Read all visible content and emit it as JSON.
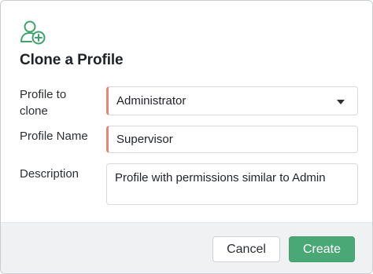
{
  "dialog": {
    "icon": "add-user-icon",
    "title": "Clone a Profile"
  },
  "form": {
    "profile_to_clone": {
      "label": "Profile to clone",
      "value": "Administrator",
      "required": true
    },
    "profile_name": {
      "label": "Profile Name",
      "value": "Supervisor",
      "required": true
    },
    "description": {
      "label": "Description",
      "value": "Profile with permissions similar to Admin"
    }
  },
  "footer": {
    "cancel_label": "Cancel",
    "create_label": "Create"
  },
  "colors": {
    "accent": "#4aa876",
    "icon": "#3ea36b",
    "required_marker": "#e0897b",
    "footer_bg": "#f0f1f3"
  }
}
